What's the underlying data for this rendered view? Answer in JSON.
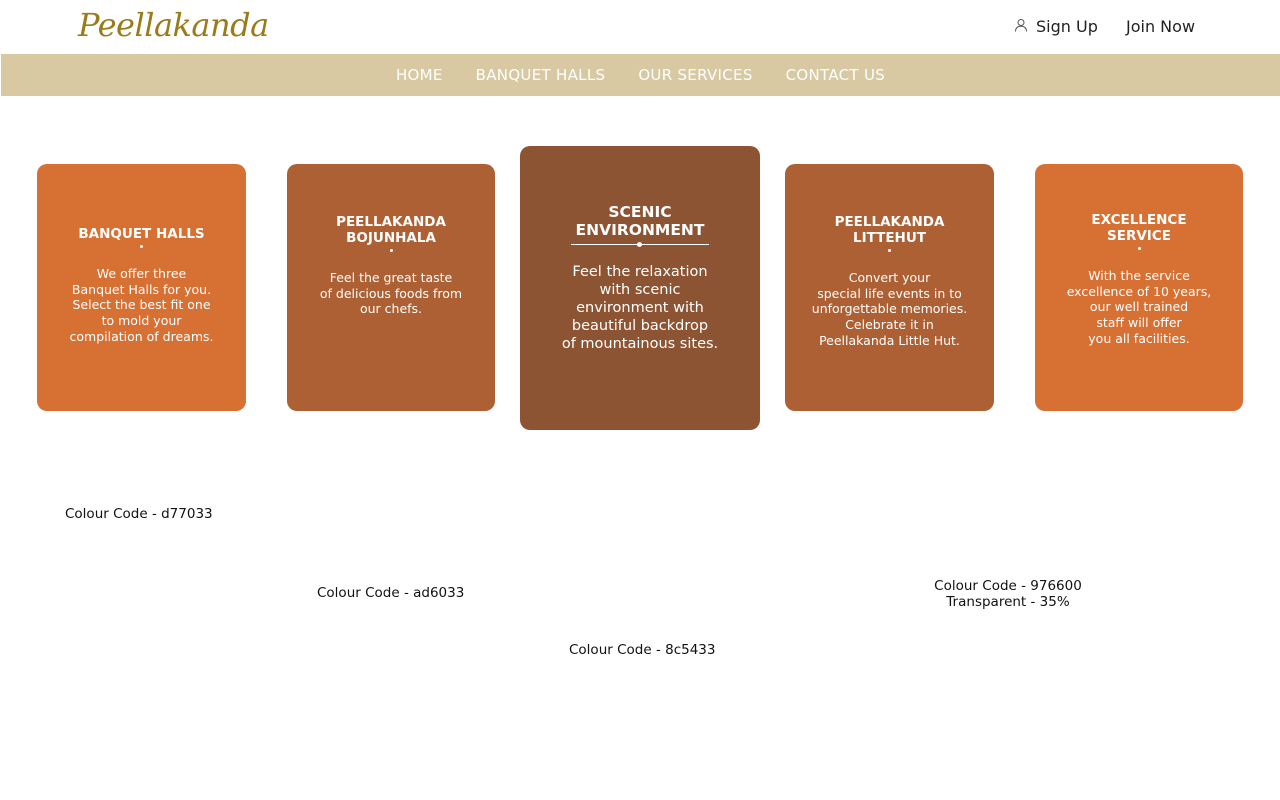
{
  "header": {
    "logo_text": "Peellakanda",
    "signup_label": "Sign Up",
    "signup_icon": "user-icon",
    "joinnow_label": "Join Now"
  },
  "nav": {
    "items": [
      {
        "label": "HOME"
      },
      {
        "label": "BANQUET HALLS"
      },
      {
        "label": "OUR SERVICES"
      },
      {
        "label": "CONTACT US"
      }
    ]
  },
  "cards": [
    {
      "title": "BANQUET HALLS",
      "body": "We offer three\nBanquet Halls for you.\nSelect the best fit one\nto mold your\ncompilation of dreams.",
      "color": "#d77033"
    },
    {
      "title": "PEELLAKANDA\nBOJUNHALA",
      "body": "Feel the great taste\nof delicious foods from\nour chefs.",
      "color": "#ad6033"
    },
    {
      "title": "SCENIC\nENVIRONMENT",
      "body": "Feel the relaxation\nwith scenic\nenvironment with\nbeautiful backdrop\nof mountainous sites.",
      "color": "#8c5433"
    },
    {
      "title": "PEELLAKANDA\nLITTEHUT",
      "body": "Convert your\nspecial life events in to\nunforgettable memories.\nCelebrate it in\nPeellakanda Little Hut.",
      "color": "#ad6033"
    },
    {
      "title": "EXCELLENCE\nSERVICE",
      "body": "With the service\nexcellence of 10 years,\nour well trained\nstaff will offer\nyou all facilities.",
      "color": "#d77033"
    }
  ],
  "notes": [
    "Colour Code - d77033",
    "Colour Code - ad6033",
    "Colour Code - 8c5433",
    "Colour Code - 976600\nTransparent - 35%"
  ]
}
